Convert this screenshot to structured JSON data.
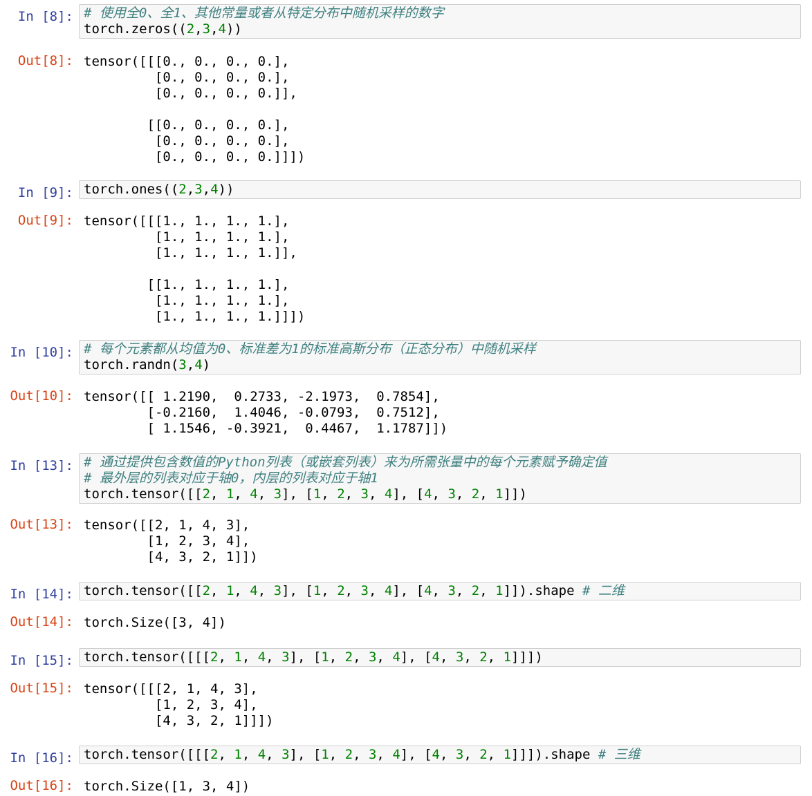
{
  "colors": {
    "in_prompt": "#303f9f",
    "out_prompt": "#d84315",
    "number": "#008000",
    "comment": "#408080",
    "input_bg": "#f7f7f7",
    "input_border": "#cfcfcf"
  },
  "cells": [
    {
      "in_prompt": "In [8]:",
      "out_prompt": "Out[8]:",
      "input": [
        [
          {
            "t": "cm",
            "v": "# 使用全0、全1、其他常量或者从特定分布中随机采样的数字"
          }
        ],
        [
          {
            "t": "p",
            "v": "torch.zeros(("
          },
          {
            "t": "n",
            "v": "2"
          },
          {
            "t": "p",
            "v": ","
          },
          {
            "t": "n",
            "v": "3"
          },
          {
            "t": "p",
            "v": ","
          },
          {
            "t": "n",
            "v": "4"
          },
          {
            "t": "p",
            "v": "))"
          }
        ]
      ],
      "output": "tensor([[[0., 0., 0., 0.],\n         [0., 0., 0., 0.],\n         [0., 0., 0., 0.]],\n\n        [[0., 0., 0., 0.],\n         [0., 0., 0., 0.],\n         [0., 0., 0., 0.]]])"
    },
    {
      "in_prompt": "In [9]:",
      "out_prompt": "Out[9]:",
      "input": [
        [
          {
            "t": "p",
            "v": "torch.ones(("
          },
          {
            "t": "n",
            "v": "2"
          },
          {
            "t": "p",
            "v": ","
          },
          {
            "t": "n",
            "v": "3"
          },
          {
            "t": "p",
            "v": ","
          },
          {
            "t": "n",
            "v": "4"
          },
          {
            "t": "p",
            "v": "))"
          }
        ]
      ],
      "output": "tensor([[[1., 1., 1., 1.],\n         [1., 1., 1., 1.],\n         [1., 1., 1., 1.]],\n\n        [[1., 1., 1., 1.],\n         [1., 1., 1., 1.],\n         [1., 1., 1., 1.]]])"
    },
    {
      "in_prompt": "In [10]:",
      "out_prompt": "Out[10]:",
      "input": [
        [
          {
            "t": "cm",
            "v": "# 每个元素都从均值为0、标准差为1的标准高斯分布（正态分布）中随机采样"
          }
        ],
        [
          {
            "t": "p",
            "v": "torch.randn("
          },
          {
            "t": "n",
            "v": "3"
          },
          {
            "t": "p",
            "v": ","
          },
          {
            "t": "n",
            "v": "4"
          },
          {
            "t": "p",
            "v": ")"
          }
        ]
      ],
      "output": "tensor([[ 1.2190,  0.2733, -2.1973,  0.7854],\n        [-0.2160,  1.4046, -0.0793,  0.7512],\n        [ 1.1546, -0.3921,  0.4467,  1.1787]])"
    },
    {
      "in_prompt": "In [13]:",
      "out_prompt": "Out[13]:",
      "input": [
        [
          {
            "t": "cm",
            "v": "# 通过提供包含数值的Python列表（或嵌套列表）来为所需张量中的每个元素赋予确定值"
          }
        ],
        [
          {
            "t": "cm",
            "v": "# 最外层的列表对应于轴0，内层的列表对应于轴1"
          }
        ],
        [
          {
            "t": "p",
            "v": "torch.tensor([["
          },
          {
            "t": "n",
            "v": "2"
          },
          {
            "t": "p",
            "v": ", "
          },
          {
            "t": "n",
            "v": "1"
          },
          {
            "t": "p",
            "v": ", "
          },
          {
            "t": "n",
            "v": "4"
          },
          {
            "t": "p",
            "v": ", "
          },
          {
            "t": "n",
            "v": "3"
          },
          {
            "t": "p",
            "v": "], ["
          },
          {
            "t": "n",
            "v": "1"
          },
          {
            "t": "p",
            "v": ", "
          },
          {
            "t": "n",
            "v": "2"
          },
          {
            "t": "p",
            "v": ", "
          },
          {
            "t": "n",
            "v": "3"
          },
          {
            "t": "p",
            "v": ", "
          },
          {
            "t": "n",
            "v": "4"
          },
          {
            "t": "p",
            "v": "], ["
          },
          {
            "t": "n",
            "v": "4"
          },
          {
            "t": "p",
            "v": ", "
          },
          {
            "t": "n",
            "v": "3"
          },
          {
            "t": "p",
            "v": ", "
          },
          {
            "t": "n",
            "v": "2"
          },
          {
            "t": "p",
            "v": ", "
          },
          {
            "t": "n",
            "v": "1"
          },
          {
            "t": "p",
            "v": "]])"
          }
        ]
      ],
      "output": "tensor([[2, 1, 4, 3],\n        [1, 2, 3, 4],\n        [4, 3, 2, 1]])"
    },
    {
      "in_prompt": "In [14]:",
      "out_prompt": "Out[14]:",
      "input": [
        [
          {
            "t": "p",
            "v": "torch.tensor([["
          },
          {
            "t": "n",
            "v": "2"
          },
          {
            "t": "p",
            "v": ", "
          },
          {
            "t": "n",
            "v": "1"
          },
          {
            "t": "p",
            "v": ", "
          },
          {
            "t": "n",
            "v": "4"
          },
          {
            "t": "p",
            "v": ", "
          },
          {
            "t": "n",
            "v": "3"
          },
          {
            "t": "p",
            "v": "], ["
          },
          {
            "t": "n",
            "v": "1"
          },
          {
            "t": "p",
            "v": ", "
          },
          {
            "t": "n",
            "v": "2"
          },
          {
            "t": "p",
            "v": ", "
          },
          {
            "t": "n",
            "v": "3"
          },
          {
            "t": "p",
            "v": ", "
          },
          {
            "t": "n",
            "v": "4"
          },
          {
            "t": "p",
            "v": "], ["
          },
          {
            "t": "n",
            "v": "4"
          },
          {
            "t": "p",
            "v": ", "
          },
          {
            "t": "n",
            "v": "3"
          },
          {
            "t": "p",
            "v": ", "
          },
          {
            "t": "n",
            "v": "2"
          },
          {
            "t": "p",
            "v": ", "
          },
          {
            "t": "n",
            "v": "1"
          },
          {
            "t": "p",
            "v": "]]).shape "
          },
          {
            "t": "cm",
            "v": "# 二维"
          }
        ]
      ],
      "output": "torch.Size([3, 4])"
    },
    {
      "in_prompt": "In [15]:",
      "out_prompt": "Out[15]:",
      "input": [
        [
          {
            "t": "p",
            "v": "torch.tensor([[["
          },
          {
            "t": "n",
            "v": "2"
          },
          {
            "t": "p",
            "v": ", "
          },
          {
            "t": "n",
            "v": "1"
          },
          {
            "t": "p",
            "v": ", "
          },
          {
            "t": "n",
            "v": "4"
          },
          {
            "t": "p",
            "v": ", "
          },
          {
            "t": "n",
            "v": "3"
          },
          {
            "t": "p",
            "v": "], ["
          },
          {
            "t": "n",
            "v": "1"
          },
          {
            "t": "p",
            "v": ", "
          },
          {
            "t": "n",
            "v": "2"
          },
          {
            "t": "p",
            "v": ", "
          },
          {
            "t": "n",
            "v": "3"
          },
          {
            "t": "p",
            "v": ", "
          },
          {
            "t": "n",
            "v": "4"
          },
          {
            "t": "p",
            "v": "], ["
          },
          {
            "t": "n",
            "v": "4"
          },
          {
            "t": "p",
            "v": ", "
          },
          {
            "t": "n",
            "v": "3"
          },
          {
            "t": "p",
            "v": ", "
          },
          {
            "t": "n",
            "v": "2"
          },
          {
            "t": "p",
            "v": ", "
          },
          {
            "t": "n",
            "v": "1"
          },
          {
            "t": "p",
            "v": "]]])"
          }
        ]
      ],
      "output": "tensor([[[2, 1, 4, 3],\n         [1, 2, 3, 4],\n         [4, 3, 2, 1]]])"
    },
    {
      "in_prompt": "In [16]:",
      "out_prompt": "Out[16]:",
      "input": [
        [
          {
            "t": "p",
            "v": "torch.tensor([[["
          },
          {
            "t": "n",
            "v": "2"
          },
          {
            "t": "p",
            "v": ", "
          },
          {
            "t": "n",
            "v": "1"
          },
          {
            "t": "p",
            "v": ", "
          },
          {
            "t": "n",
            "v": "4"
          },
          {
            "t": "p",
            "v": ", "
          },
          {
            "t": "n",
            "v": "3"
          },
          {
            "t": "p",
            "v": "], ["
          },
          {
            "t": "n",
            "v": "1"
          },
          {
            "t": "p",
            "v": ", "
          },
          {
            "t": "n",
            "v": "2"
          },
          {
            "t": "p",
            "v": ", "
          },
          {
            "t": "n",
            "v": "3"
          },
          {
            "t": "p",
            "v": ", "
          },
          {
            "t": "n",
            "v": "4"
          },
          {
            "t": "p",
            "v": "], ["
          },
          {
            "t": "n",
            "v": "4"
          },
          {
            "t": "p",
            "v": ", "
          },
          {
            "t": "n",
            "v": "3"
          },
          {
            "t": "p",
            "v": ", "
          },
          {
            "t": "n",
            "v": "2"
          },
          {
            "t": "p",
            "v": ", "
          },
          {
            "t": "n",
            "v": "1"
          },
          {
            "t": "p",
            "v": "]]]).shape "
          },
          {
            "t": "cm",
            "v": "# 三维"
          }
        ]
      ],
      "output": "torch.Size([1, 3, 4])"
    }
  ]
}
